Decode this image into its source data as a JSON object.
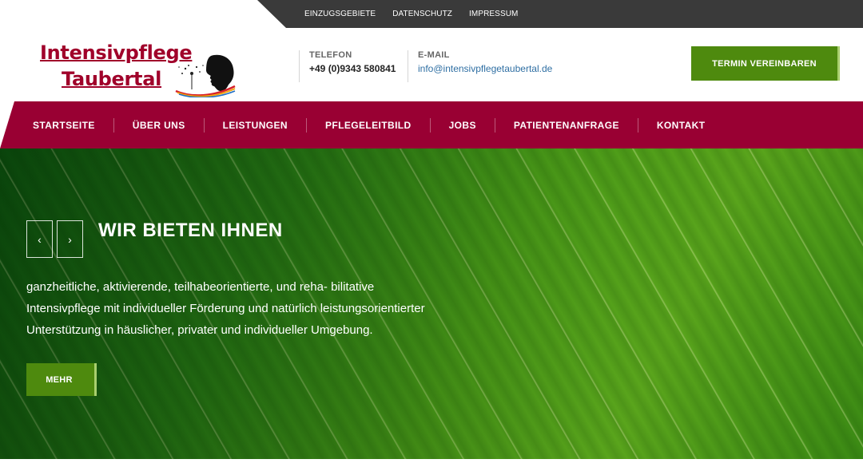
{
  "topbar": {
    "links": [
      "EINZUGSGEBIETE",
      "DATENSCHUTZ",
      "IMPRESSUM"
    ]
  },
  "logo": {
    "line1": "Intensivpflege",
    "line2": "Taubertal",
    "mark_icon": "dandelion-face-icon"
  },
  "contact": {
    "phone_label": "TELEFON",
    "phone_value": "+49 (0)9343 580841",
    "email_label": "E-MAIL",
    "email_value": "info@intensivpflegetaubertal.de"
  },
  "cta": {
    "label": "TERMIN VEREINBAREN"
  },
  "nav": {
    "items": [
      "STARTSEITE",
      "ÜBER UNS",
      "LEISTUNGEN",
      "PFLEGELEITBILD",
      "JOBS",
      "PATIENTENANFRAGE",
      "KONTAKT"
    ]
  },
  "hero": {
    "prev_icon": "‹",
    "next_icon": "›",
    "title": "WIR BIETEN IHNEN",
    "text": "ganzheitliche, aktivierende, teilhabeorientierte, und reha- bilitative Intensivpflege mit individueller Förderung und natürlich leistungsorientierter Unterstützung in häuslicher, privater und individueller Umgebung.",
    "more_label": "MEHR"
  },
  "colors": {
    "brand_red": "#990033",
    "brand_green": "#4e8a0e",
    "topbar": "#3a3a3a"
  }
}
